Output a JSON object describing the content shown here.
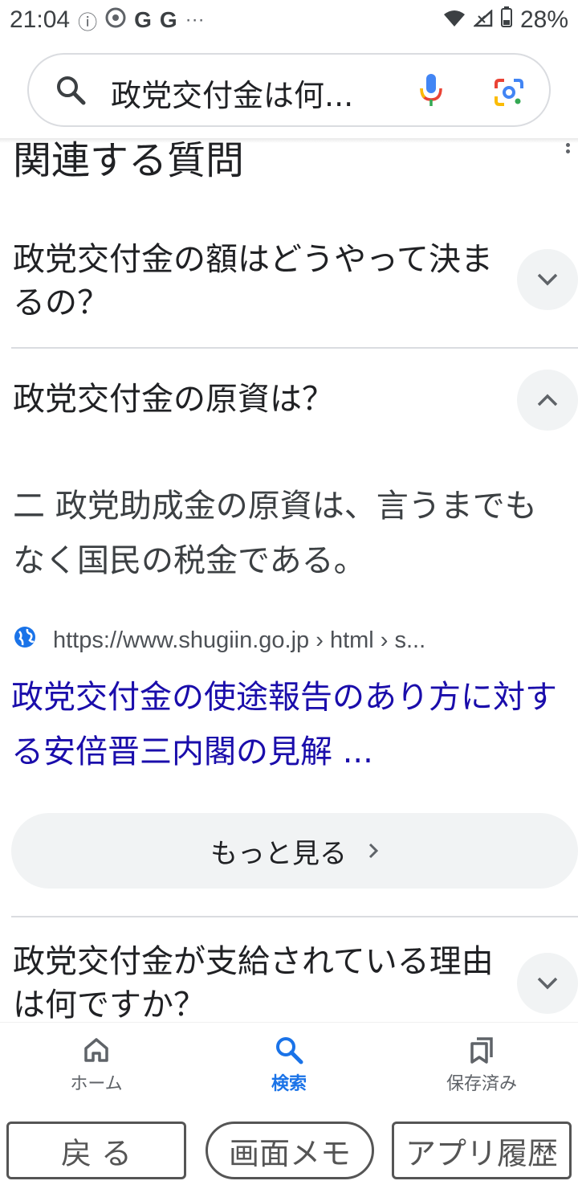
{
  "status_bar": {
    "time": "21:04",
    "left_icons": [
      "info-icon",
      "radiko-icon",
      "google-icon",
      "google-icon",
      "more-dots"
    ],
    "g1": "G",
    "g2": "G",
    "dots": "···",
    "battery": "28%"
  },
  "search": {
    "query": "政党交付金は何..."
  },
  "section": {
    "title": "関連する質問"
  },
  "questions": [
    {
      "text": "政党交付金の額はどうやって決まるの？",
      "expanded": false
    },
    {
      "text": "政党交付金の原資は？",
      "expanded": true,
      "answer": "二 政党助成金の原資は、言うまでもなく国民の税金である。",
      "source_url": "https://www.shugiin.go.jp › html › s...",
      "result_title": "政党交付金の使途報告のあり方に対する安倍晋三内閣の見解 ...",
      "more_label": "もっと見る"
    },
    {
      "text": "政党交付金が支給されている理由は何ですか？",
      "expanded": false
    }
  ],
  "bottom_nav": {
    "items": [
      {
        "label": "ホーム",
        "icon": "home-icon",
        "active": false
      },
      {
        "label": "検索",
        "icon": "search-icon",
        "active": true
      },
      {
        "label": "保存済み",
        "icon": "bookmarks-icon",
        "active": false
      }
    ]
  },
  "system_buttons": {
    "back": "戻 る",
    "screen_memo": "画面メモ",
    "app_history": "アプリ履歴"
  },
  "colors": {
    "link": "#1a0dab",
    "active_nav": "#1a73e8",
    "chip_bg": "#f1f3f4"
  }
}
